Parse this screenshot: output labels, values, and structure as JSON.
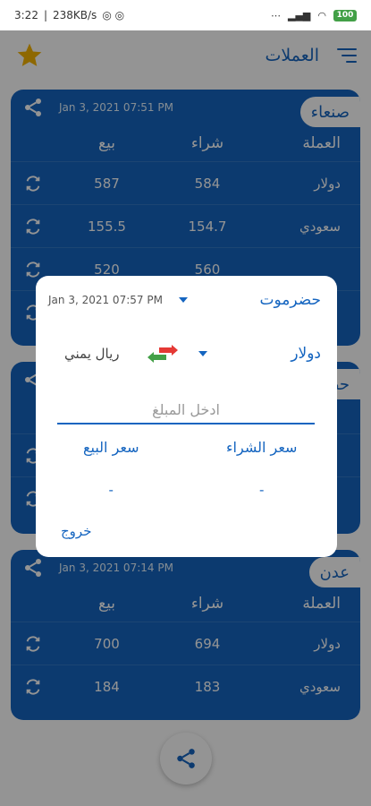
{
  "status_bar": {
    "time": "3:22",
    "speed": "238KB/s",
    "battery": "100"
  },
  "app_bar": {
    "title": "العملات"
  },
  "columns": {
    "currency": "العملة",
    "buy": "شراء",
    "sell": "بيع"
  },
  "cards": [
    {
      "city": "صنعاء",
      "timestamp": "Jan 3, 2021 07:51 PM",
      "rows": [
        {
          "currency": "دولار",
          "buy": "584",
          "sell": "587"
        },
        {
          "currency": "سعودي",
          "buy": "154.7",
          "sell": "155.5"
        },
        {
          "currency": "",
          "buy": "560",
          "sell": "520"
        },
        {
          "currency": "",
          "buy": "",
          "sell": ""
        }
      ]
    },
    {
      "city": "حضرموت",
      "timestamp": "",
      "rows": []
    },
    {
      "city": "عدن",
      "timestamp": "Jan 3, 2021 07:14 PM",
      "rows": [
        {
          "currency": "دولار",
          "buy": "694",
          "sell": "700"
        },
        {
          "currency": "سعودي",
          "buy": "183",
          "sell": "184"
        }
      ]
    }
  ],
  "dialog": {
    "timestamp": "Jan 3, 2021 07:57 PM",
    "region": "حضرموت",
    "from_currency": "دولار",
    "to_currency": "ريال يمني",
    "amount_placeholder": "ادخل المبلغ",
    "buy_label": "سعر الشراء",
    "sell_label": "سعر البيع",
    "buy_value": "-",
    "sell_value": "-",
    "exit_label": "خروج"
  },
  "colors": {
    "primary": "#1565c0",
    "star": "#f4b400",
    "swap_green": "#43a047",
    "swap_red": "#e53935"
  }
}
